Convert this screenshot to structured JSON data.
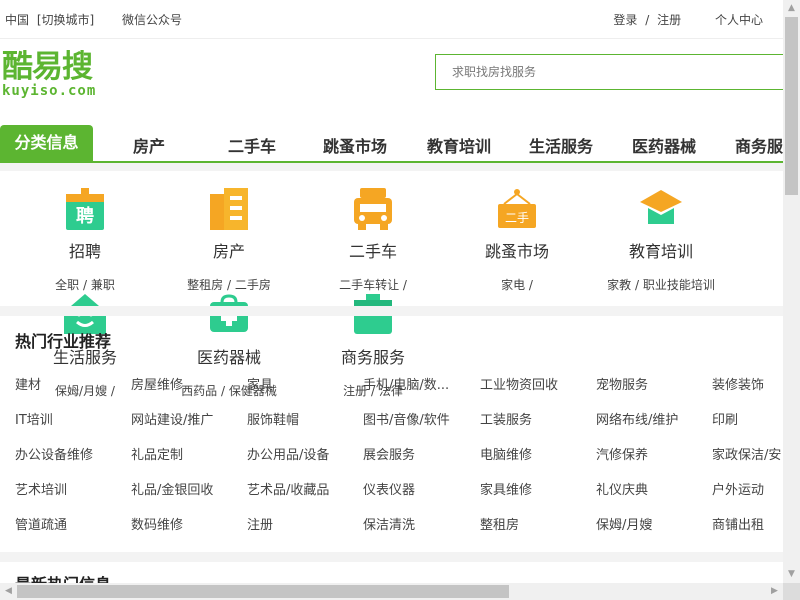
{
  "topbar": {
    "city": "中国",
    "switch_city": "[切换城市]",
    "wechat": "微信公众号",
    "login": "登录",
    "sep": "/",
    "register": "注册",
    "user_center": "个人中心"
  },
  "logo": {
    "cn": "酷易搜",
    "en": "kuyiso.com"
  },
  "search": {
    "placeholder": "求职找房找服务"
  },
  "nav": {
    "active": "分类信息",
    "items": [
      "房产",
      "二手车",
      "跳蚤市场",
      "教育培训",
      "生活服务",
      "医药器械",
      "商务服"
    ]
  },
  "categories": [
    {
      "name": "招聘",
      "subs": "全职 / 兼职",
      "icon": "recruit-icon",
      "badge": "聘"
    },
    {
      "name": "房产",
      "subs": "整租房 /  二手房",
      "icon": "building-icon"
    },
    {
      "name": "二手车",
      "subs": "二手车转让 /",
      "icon": "car-icon"
    },
    {
      "name": "跳蚤市场",
      "subs": "家电 /",
      "icon": "secondhand-sign-icon",
      "badge": "二手"
    },
    {
      "name": "教育培训",
      "subs": "家教 /  职业技能培训",
      "icon": "graduation-cap-icon"
    },
    {
      "name": "生活服务",
      "subs": "保姆/月嫂 /",
      "icon": "smiley-house-icon"
    },
    {
      "name": "医药器械",
      "subs": "西药品 /  保健器械",
      "icon": "medical-kit-icon"
    },
    {
      "name": "商务服务",
      "subs": "注册 /  法律",
      "icon": "briefcase-icon"
    }
  ],
  "hot": {
    "title": "热门行业推荐",
    "rows": [
      [
        "建材",
        "房屋维修",
        "家具",
        "手机/电脑/数...",
        "工业物资回收",
        "宠物服务",
        "装修装饰"
      ],
      [
        "IT培训",
        "网站建设/推广",
        "服饰鞋帽",
        "图书/音像/软件",
        "工装服务",
        "网络布线/维护",
        "印刷"
      ],
      [
        "办公设备维修",
        "礼品定制",
        "办公用品/设备",
        "展会服务",
        "电脑维修",
        "汽修保养",
        "家政保洁/安"
      ],
      [
        "艺术培训",
        "礼品/金银回收",
        "艺术品/收藏品",
        "仪表仪器",
        "家具维修",
        "礼仪庆典",
        "户外运动"
      ],
      [
        "管道疏通",
        "数码维修",
        "注册",
        "保洁清洗",
        "整租房",
        "保姆/月嫂",
        "商铺出租"
      ]
    ]
  },
  "latest": {
    "title": "最新热门信息"
  },
  "colors": {
    "brand": "#5cb531",
    "orange": "#f5a623",
    "teal": "#2ecc8f"
  }
}
